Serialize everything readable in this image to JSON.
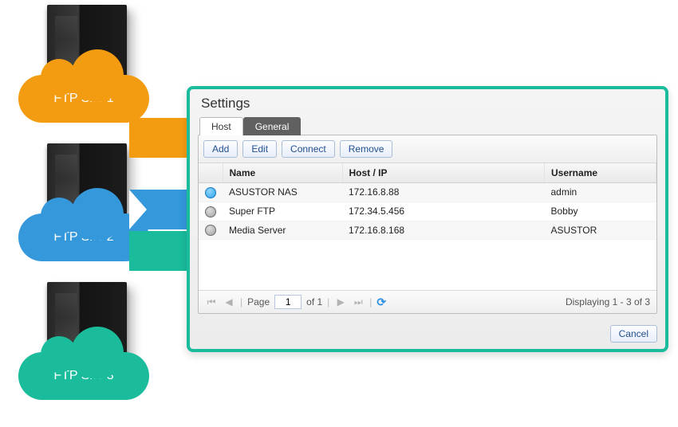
{
  "sites": [
    {
      "label": "FTP Site 1"
    },
    {
      "label": "FTP Site 2"
    },
    {
      "label": "FTP Site 3"
    }
  ],
  "window": {
    "title": "Settings"
  },
  "tabs": {
    "host": "Host",
    "general": "General"
  },
  "toolbar": {
    "add": "Add",
    "edit": "Edit",
    "connect": "Connect",
    "remove": "Remove"
  },
  "columns": {
    "icon": "",
    "name": "Name",
    "host": "Host / IP",
    "user": "Username"
  },
  "rows": [
    {
      "icon": "blue",
      "name": "ASUSTOR NAS",
      "host": "172.16.8.88",
      "user": "admin"
    },
    {
      "icon": "gray",
      "name": "Super FTP",
      "host": "172.34.5.456",
      "user": "Bobby"
    },
    {
      "icon": "gray",
      "name": "Media Server",
      "host": "172.16.8.168",
      "user": "ASUSTOR"
    }
  ],
  "pager": {
    "page_label": "Page",
    "page_value": "1",
    "of_label": "of 1",
    "summary": "Displaying 1 - 3 of 3"
  },
  "footer": {
    "cancel": "Cancel"
  }
}
